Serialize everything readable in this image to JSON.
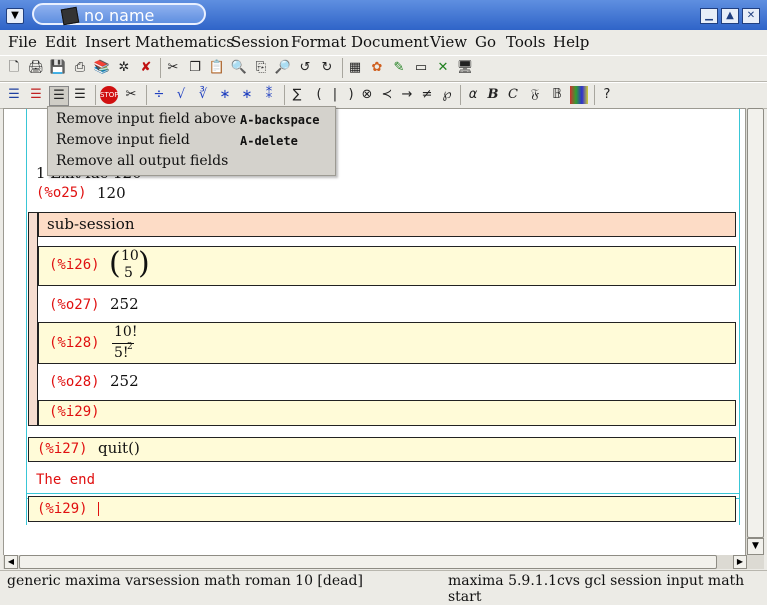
{
  "window": {
    "title": "no name"
  },
  "menubar": [
    "File",
    "Edit",
    "Insert",
    "Mathematics",
    "Session",
    "Format",
    "Document",
    "View",
    "Go",
    "Tools",
    "Help"
  ],
  "popup_menu": {
    "items": [
      {
        "label": "Remove input field above",
        "shortcut": "A-backspace"
      },
      {
        "label": "Remove input field",
        "shortcut": "A-delete"
      },
      {
        "label": "Remove all output fields",
        "shortcut": ""
      }
    ]
  },
  "session": {
    "partial_line": "1 Exit fac 120",
    "o25_prompt": "(%o25)",
    "o25_value": "120",
    "subsession_title": "sub-session",
    "i26_prompt": "(%i26)",
    "i26_binom_top": "10",
    "i26_binom_bottom": "5",
    "o27_prompt": "(%o27)",
    "o27_value": "252",
    "i28_prompt": "(%i28)",
    "i28_numerator": "10!",
    "i28_denominator": "5!",
    "i28_exponent": "2",
    "o28_prompt": "(%o28)",
    "o28_value": "252",
    "i29_prompt": "(%i29)",
    "i27_prompt": "(%i27)",
    "i27_input": "quit()",
    "end_text": "The end",
    "last_prompt": "(%i29)"
  },
  "statusbar": {
    "left": "generic maxima varsession math roman 10 [dead]",
    "right": "maxima 5.9.1.1cvs gcl session input math start"
  },
  "icons": {
    "toolbar1": [
      "new-icon",
      "open-icon",
      "save-icon",
      "print-icon",
      "export-icon",
      "web-icon",
      "close-doc-icon",
      "cut-icon",
      "copy-icon",
      "paste-icon",
      "search-icon",
      "replace-icon",
      "spell-icon",
      "undo-icon",
      "redo-icon",
      "table-icon",
      "image-icon",
      "draw-icon",
      "frame-icon",
      "session-icon",
      "screen-icon"
    ],
    "toolbar2": [
      "align-left-icon",
      "align-center-icon",
      "align-right-icon",
      "justify-icon",
      "stop-icon",
      "scissors-icon",
      "fraction-icon",
      "sqrt-icon",
      "nth-root-icon",
      "subscript-icon",
      "superscript-icon",
      "above-below-icon",
      "sum-icon",
      "parens-icon",
      "bar-icon",
      "close-paren-icon",
      "otimes-icon",
      "prec-icon",
      "arrow-icon",
      "neq-icon",
      "weierstrass-icon",
      "alpha-icon",
      "bold-b-icon",
      "calligraphic-c-icon",
      "fraktur-f-icon",
      "blackboard-b-icon",
      "color-icon",
      "help-icon"
    ]
  }
}
